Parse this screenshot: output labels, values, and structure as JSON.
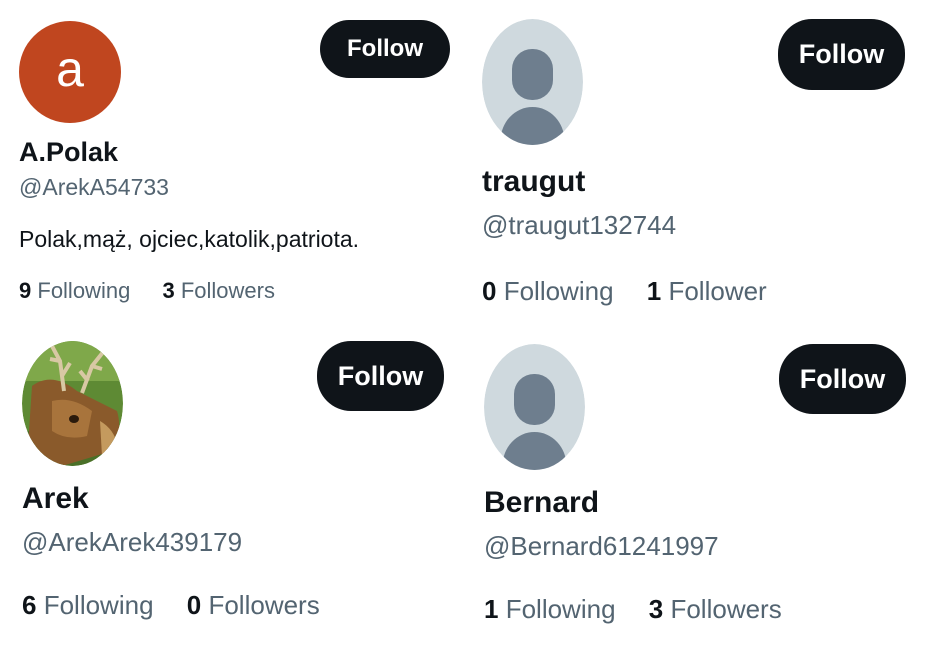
{
  "accounts": [
    {
      "name": "A.Polak",
      "handle": "@ArekA54733",
      "bio": "Polak,mąż, ojciec,katolik,patriota.",
      "avatar_letter": "a",
      "following_count": "9",
      "following_label": "Following",
      "followers_count": "3",
      "followers_label": "Followers",
      "follow_label": "Follow"
    },
    {
      "name": "traugut",
      "handle": "@traugut132744",
      "following_count": "0",
      "following_label": "Following",
      "followers_count": "1",
      "followers_label": "Follower",
      "follow_label": "Follow"
    },
    {
      "name": "Arek",
      "handle": "@ArekArek439179",
      "following_count": "6",
      "following_label": "Following",
      "followers_count": "0",
      "followers_label": "Followers",
      "follow_label": "Follow"
    },
    {
      "name": "Bernard",
      "handle": "@Bernard61241997",
      "following_count": "1",
      "following_label": "Following",
      "followers_count": "3",
      "followers_label": "Followers",
      "follow_label": "Follow"
    }
  ],
  "icons": {
    "default_avatar": "default-profile-icon",
    "deer_avatar": "deer-photo-icon"
  },
  "colors": {
    "button_bg": "#0f1419",
    "text_primary": "#0f1419",
    "text_secondary": "#536471",
    "avatar_letter_bg": "#c0461f",
    "default_avatar_bg": "#cfd9de",
    "default_avatar_fg": "#6e7e8e"
  }
}
